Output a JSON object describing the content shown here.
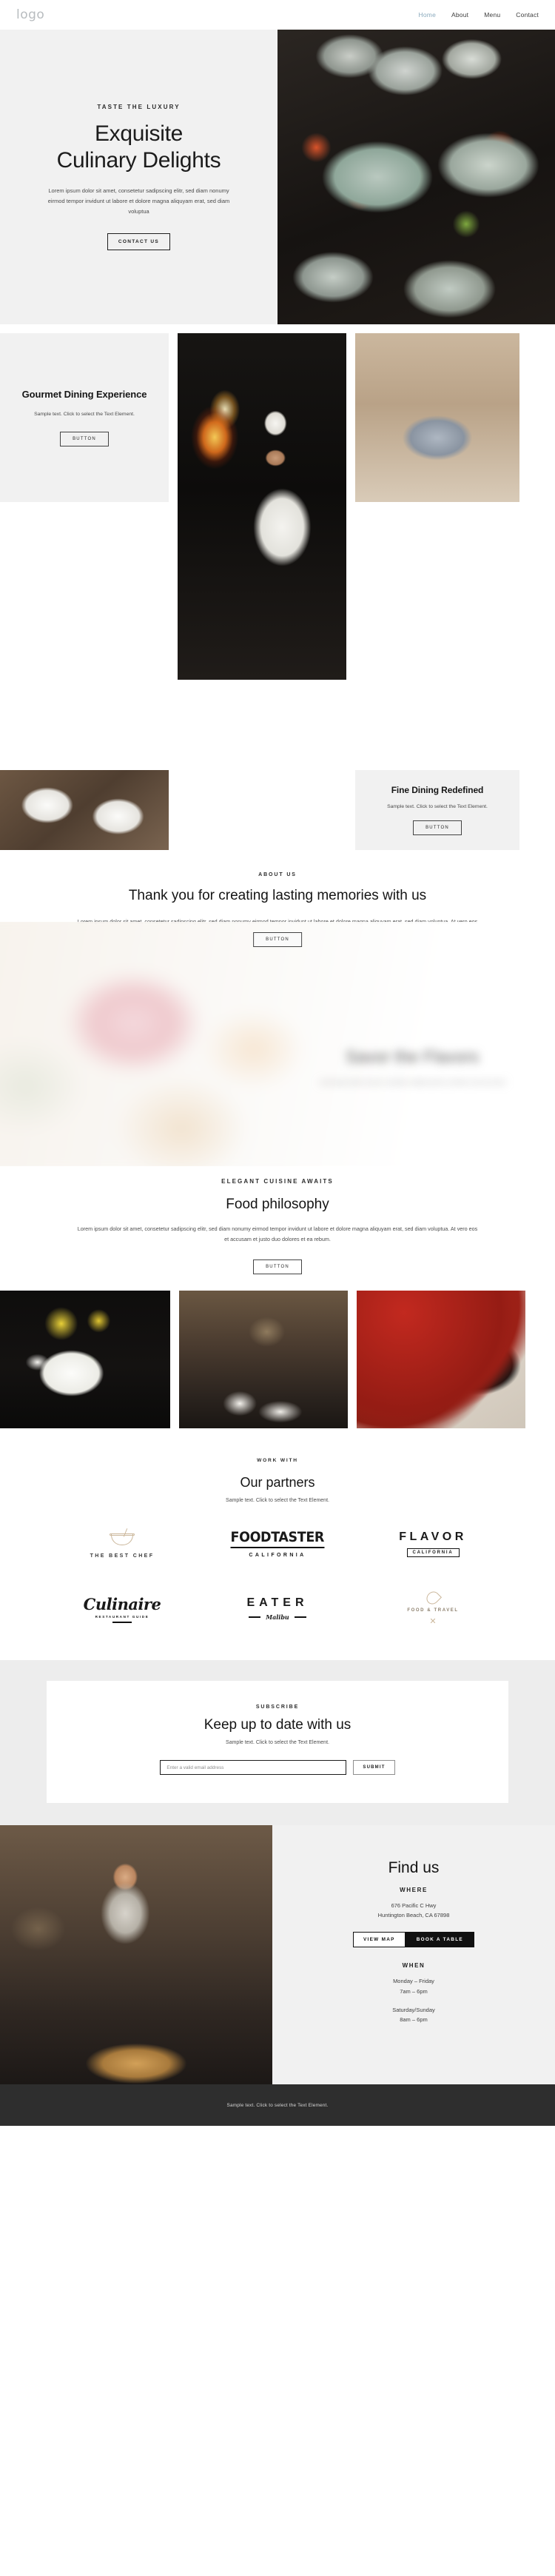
{
  "header": {
    "logo": "logo",
    "nav": [
      {
        "label": "Home",
        "active": true
      },
      {
        "label": "About",
        "active": false
      },
      {
        "label": "Menu",
        "active": false
      },
      {
        "label": "Contact",
        "active": false
      }
    ]
  },
  "hero": {
    "eyebrow": "TASTE THE LUXURY",
    "title_line1": "Exquisite",
    "title_line2": "Culinary Delights",
    "paragraph": "Lorem ipsum dolor sit amet, consetetur sadipscing elitr, sed diam nonumy eirmod tempor invidunt ut labore et dolore magna aliquyam erat, sed diam voluptua",
    "cta": "CONTACT US"
  },
  "features": {
    "gourmet": {
      "title": "Gourmet Dining Experience",
      "text": "Sample text. Click to select the Text Element.",
      "button": "BUTTON"
    },
    "fine": {
      "title": "Fine Dining Redefined",
      "text": "Sample text. Click to select the Text Element.",
      "button": "BUTTON"
    }
  },
  "about": {
    "eyebrow": "ABOUT US",
    "title": "Thank you for creating lasting memories with us",
    "paragraph": "Lorem ipsum dolor sit amet, consetetur sadipscing elitr, sed diam nonumy eirmod tempor invidunt ut labore et dolore magna aliquyam erat, sed diam voluptua. At vero eos et accusam et justo duo dolores et ea rebum.",
    "button": "BUTTON"
  },
  "savor": {
    "title": "Savor the Flavors",
    "paragraph": "Lorem ipsum dolor sit amet, consetetur sadipscing elitr, sed diam nonumy eirmod"
  },
  "philosophy": {
    "eyebrow": "ELEGANT CUISINE AWAITS",
    "title": "Food philosophy",
    "paragraph": "Lorem ipsum dolor sit amet, consetetur sadipscing elitr, sed diam nonumy eirmod tempor invidunt ut labore et dolore magna aliquyam erat, sed diam voluptua. At vero eos et accusam et justo duo dolores et ea rebum.",
    "button": "BUTTON"
  },
  "partners": {
    "eyebrow": "WORK WITH",
    "title": "Our partners",
    "subtitle": "Sample text. Click to select the Text Element.",
    "logos": [
      {
        "name": "THE BEST CHEF",
        "sub": ""
      },
      {
        "name": "FOODTASTER",
        "sub": "CALIFORNIA"
      },
      {
        "name": "FLAVOR",
        "sub": "CALIFORNIA"
      },
      {
        "name": "Culinaire",
        "sub": "RESTAURANT GUIDE"
      },
      {
        "name": "EATER",
        "sub": "Malibu"
      },
      {
        "name": "FOOD & TRAVEL",
        "sub": ""
      }
    ]
  },
  "subscribe": {
    "eyebrow": "SUBSCRIBE",
    "title": "Keep up to date with us",
    "subtitle": "Sample text. Click to select the Text Element.",
    "placeholder": "Enter a valid email address",
    "submit": "SUBMIT"
  },
  "findus": {
    "title": "Find us",
    "where_label": "WHERE",
    "address_line1": "676 Pacific C Hwy",
    "address_line2": "Huntington Beach, CA 67898",
    "view_map": "VIEW MAP",
    "book_table": "BOOK A TABLE",
    "when_label": "WHEN",
    "weekday_days": "Monday – Friday",
    "weekday_hours": "7am – 6pm",
    "weekend_days": "Saturday/Sunday",
    "weekend_hours": "8am – 6pm"
  },
  "footer": {
    "text": "Sample text. Click to select the Text Element."
  }
}
